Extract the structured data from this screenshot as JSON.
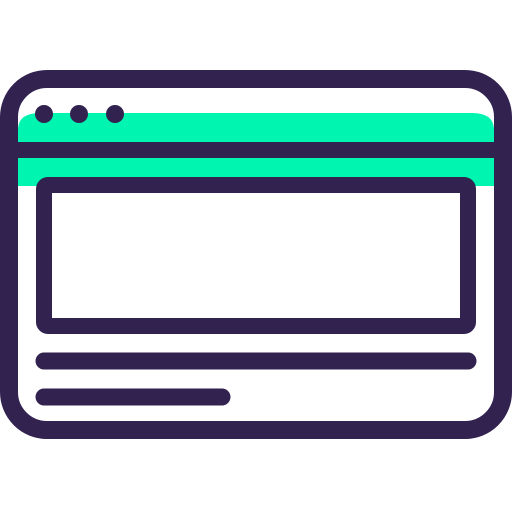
{
  "icon": {
    "name": "browser-window-icon",
    "colors": {
      "outline": "#32224f",
      "accent": "#00f5b0",
      "background": "#ffffff"
    },
    "window_control_dots": 3,
    "content_lines": [
      {
        "name": "full-width-line",
        "length_fraction": 1.0
      },
      {
        "name": "short-line",
        "length_fraction": 0.44
      }
    ]
  }
}
